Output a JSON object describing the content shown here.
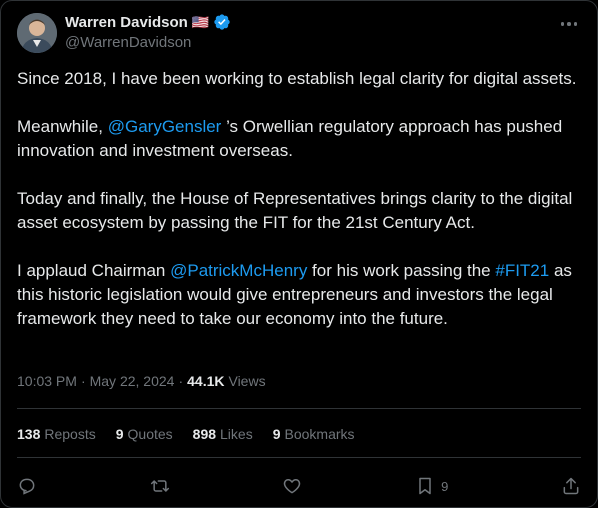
{
  "author": {
    "name": "Warren Davidson",
    "flag": "🇺🇸",
    "handle": "@WarrenDavidson"
  },
  "tweet": {
    "p1": "Since 2018, I have been working to establish legal clarity for digital assets.",
    "p2_before": "Meanwhile, ",
    "p2_mention": "@GaryGensler",
    "p2_after": " ’s Orwellian regulatory approach has pushed innovation and investment overseas.",
    "p3": "Today and finally, the House of Representatives brings clarity to the digital asset ecosystem by passing the FIT for the 21st Century Act.",
    "p4_before": "I applaud Chairman ",
    "p4_mention": "@PatrickMcHenry",
    "p4_middle": " for his work passing the ",
    "p4_hashtag": "#FIT21",
    "p4_after": " as this historic legislation would give entrepreneurs and investors the legal framework they need to take our economy into the future."
  },
  "meta": {
    "time": "10:03 PM",
    "sep1": "·",
    "date": "May 22, 2024",
    "sep2": "·",
    "views_count": "44.1K",
    "views_label": "Views"
  },
  "stats": {
    "reposts_count": "138",
    "reposts_label": "Reposts",
    "quotes_count": "9",
    "quotes_label": "Quotes",
    "likes_count": "898",
    "likes_label": "Likes",
    "bookmarks_count": "9",
    "bookmarks_label": "Bookmarks"
  },
  "actions": {
    "bookmark_count": "9"
  },
  "colors": {
    "background": "#000000",
    "text": "#e7e9ea",
    "muted": "#71767b",
    "link": "#1d9bf0",
    "border": "#2f3336"
  }
}
